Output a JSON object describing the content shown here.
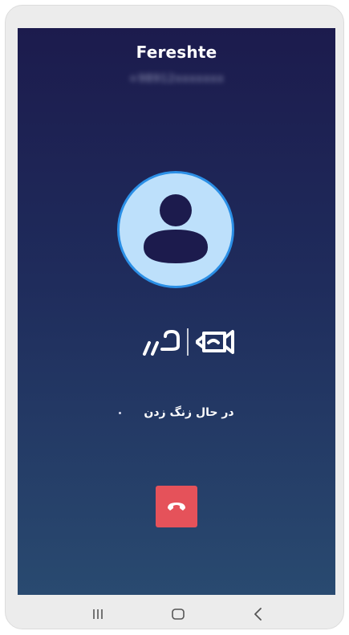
{
  "call": {
    "caller_name": "Fereshte",
    "caller_number": "+98912xxxxxxx",
    "status_text": "در حال زنگ زدن",
    "status_indicator": "dot"
  },
  "brand": {
    "icon": "video-camera-logo",
    "logo_text": "قرار"
  },
  "controls": {
    "end_call_icon": "phone-hangup-icon",
    "end_call_color": "#e5525a"
  },
  "navbar": {
    "items": [
      {
        "icon": "recent-apps-icon"
      },
      {
        "icon": "home-icon"
      },
      {
        "icon": "back-icon"
      }
    ]
  },
  "colors": {
    "gradient_top": "#1c1b4d",
    "gradient_bottom": "#294a70",
    "avatar_fill": "#bde0fb",
    "avatar_border": "#2b8fe6"
  }
}
